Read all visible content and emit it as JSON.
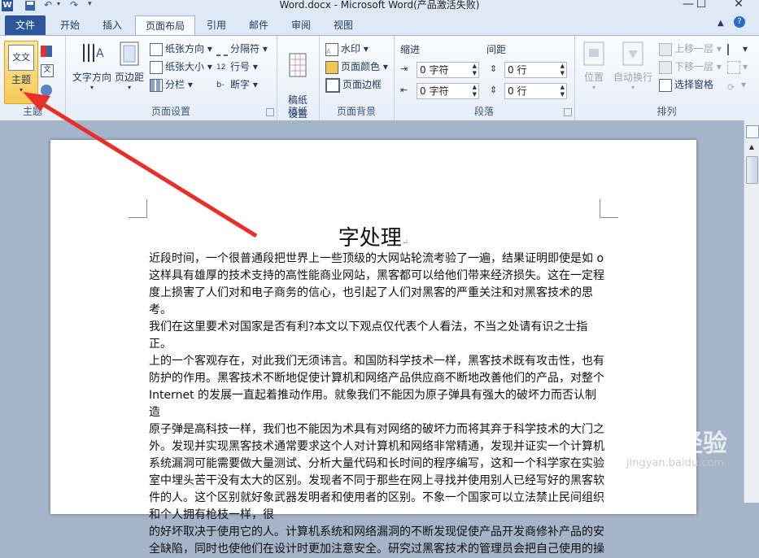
{
  "window": {
    "title": "Word.docx - Microsoft Word(产品激活失败)",
    "minimize": "—",
    "maximize": "☐",
    "close": "✕"
  },
  "tabs": [
    "文件",
    "开始",
    "插入",
    "页面布局",
    "引用",
    "邮件",
    "审阅",
    "视图"
  ],
  "ribbon": {
    "theme": {
      "label": "主题",
      "group_label": "主题",
      "icon": "theme-icon",
      "icon_text": "文文"
    },
    "page_setup": {
      "group_label": "页面设置",
      "text_direction": "文字方向",
      "margins": "页边距",
      "orientation": "纸张方向",
      "size": "纸张大小",
      "columns": "分栏",
      "breaks": "分隔符",
      "line_numbers": "行号",
      "hyphenation": "断字"
    },
    "manuscript": {
      "group_label": "稿纸",
      "setting": "稿纸\n设置"
    },
    "page_background": {
      "group_label": "页面背景",
      "watermark": "水印",
      "page_color": "页面颜色",
      "page_borders": "页面边框"
    },
    "paragraph": {
      "group_label": "段落",
      "indent_label": "缩进",
      "spacing_label": "间距",
      "indent_left": "0 字符",
      "indent_right": "0 字符",
      "spacing_before": "0 行",
      "spacing_after": "0 行"
    },
    "arrange": {
      "group_label": "排列",
      "position": "位置",
      "wrap_text": "自动换行",
      "bring_forward": "上移一层",
      "send_backward": "下移一层",
      "selection_pane": "选择窗格"
    }
  },
  "document": {
    "title": "字处理",
    "paragraphs": [
      "近段时间，一个很普通段把世界上一些顶级的大网站轮流考验了一遍，结果证明即使是如 o",
      "这样具有雄厚的技术支持的高性能商业网站，黑客都可以给他们带来经济损失。这在一定程",
      "度上损害了人们对和电子商务的信心，也引起了人们对黑客的严重关注和对黑客技术的思考。",
      "我们在这里要术对国家是否有利?本文以下观点仅代表个人看法，不当之处请有识之士指正。",
      "上的一个客观存在，对此我们无须讳言。和国防科学技术一样，黑客技术既有攻击性，也有",
      "防护的作用。黑客技术不断地促使计算机和网络产品供应商不断地改善他们的产品，对整个",
      "Internet 的发展一直起着推动作用。就象我们不能因为原子弹具有强大的破坏力而否认制造",
      "原子弹是高科技一样，我们也不能因为术具有对网络的破坏力而将其弃于科学技术的大门之",
      "外。发现并实现黑客技术通常要求这个人对计算机和网络非常精通，发现并证实一个计算机",
      "系统漏洞可能需要做大量测试、分析大量代码和长时间的程序编写，这和一个科学家在实验",
      "室中埋头苦干没有太大的区别。发现者不同于那些在网上寻找并使用别人已经写好的黑客软",
      "件的人。这个区别就好象武器发明者和使用者的区别。不象一个国家可以立法禁止民间组织",
      "和个人拥有枪枝一样，很",
      "的好坏取决于使用它的人。计算机系统和网络漏洞的不断发现促使产品开发商修补产品的安",
      "全缺陷，同时也使他们在设计时更加注意安全。研究过黑客技术的管理员会把自己使用的操"
    ]
  },
  "watermark_text": "Bai 经验",
  "watermark_sub": "jingyan.baidu.com",
  "colors": {
    "file_tab": "#2b579a",
    "arrow": "#e8302a",
    "theme_highlight": "#f8c955"
  }
}
